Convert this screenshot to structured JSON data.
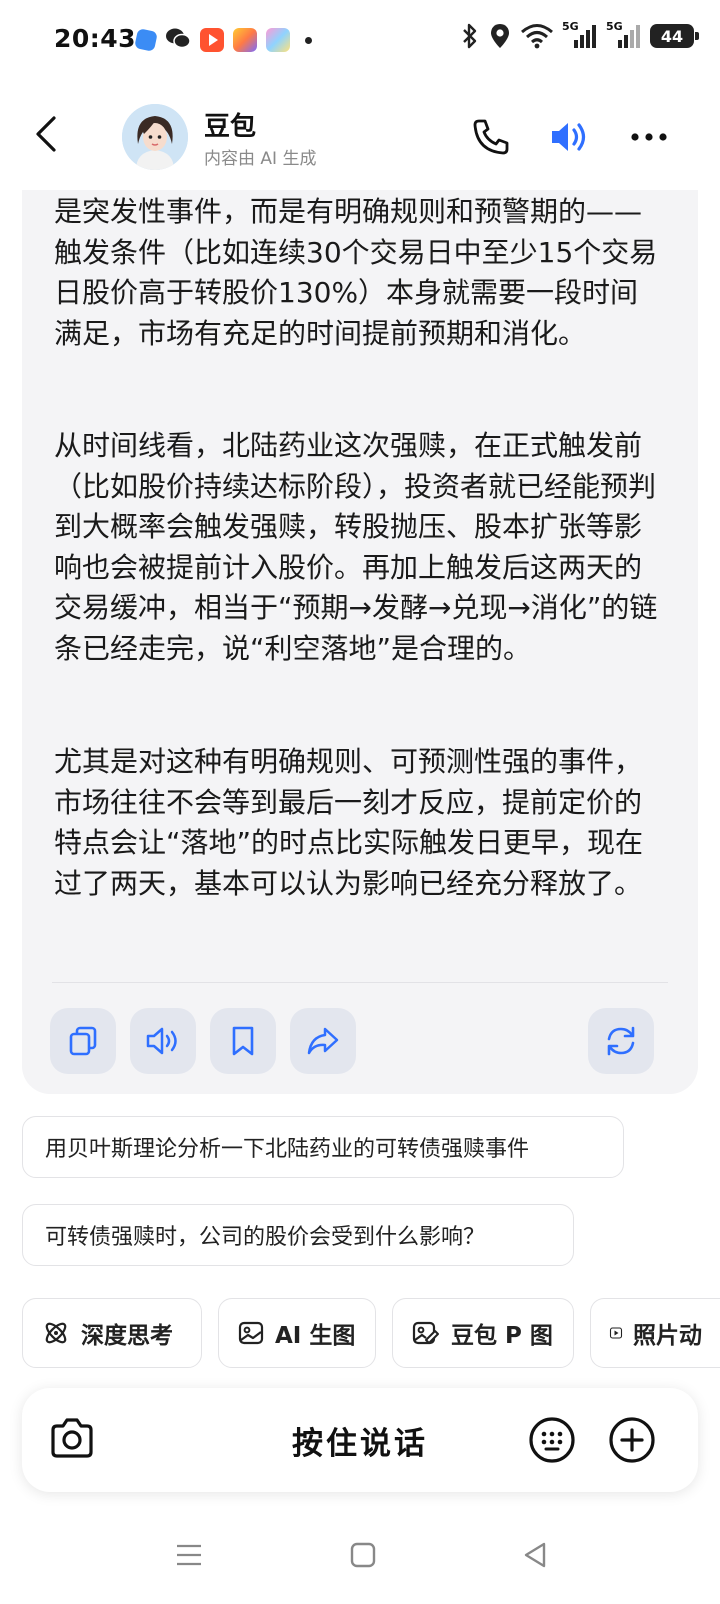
{
  "status_bar": {
    "time": "20:43",
    "battery": "44",
    "network_1": "5G",
    "network_2": "5G"
  },
  "header": {
    "name": "豆包",
    "subtitle": "内容由 AI 生成"
  },
  "message": {
    "paragraphs": [
      "是突发性事件，而是有明确规则和预警期的——触发条件（比如连续30个交易日中至少15个交易日股价高于转股价130%）本身就需要一段时间满足，市场有充足的时间提前预期和消化。",
      "从时间线看，北陆药业这次强赎，在正式触发前（比如股价持续达标阶段），投资者就已经能预判到大概率会触发强赎，转股抛压、股本扩张等影响也会被提前计入股价。再加上触发后这两天的交易缓冲，相当于“预期→发酵→兑现→消化”的链条已经走完，说“利空落地”是合理的。",
      "尤其是对这种有明确规则、可预测性强的事件，市场往往不会等到最后一刻才反应，提前定价的特点会让“落地”的时点比实际触发日更早，现在过了两天，基本可以认为影响已经充分释放了。"
    ],
    "actions": [
      "copy-icon",
      "speaker-icon",
      "bookmark-icon",
      "share-icon",
      "regenerate-icon"
    ]
  },
  "suggestions": [
    "用贝叶斯理论分析一下北陆药业的可转债强赎事件",
    "可转债强赎时，公司的股价会受到什么影响？"
  ],
  "tools": [
    {
      "label": "深度思考",
      "icon": "atom-icon"
    },
    {
      "label": "AI 生图",
      "icon": "image-icon"
    },
    {
      "label": "豆包 P 图",
      "icon": "image-edit-icon"
    },
    {
      "label": "照片动",
      "icon": "play-icon"
    }
  ],
  "input": {
    "hold_to_talk": "按住说话"
  },
  "colors": {
    "accent": "#2f6fff",
    "bubble_bg": "#f4f4f6"
  }
}
